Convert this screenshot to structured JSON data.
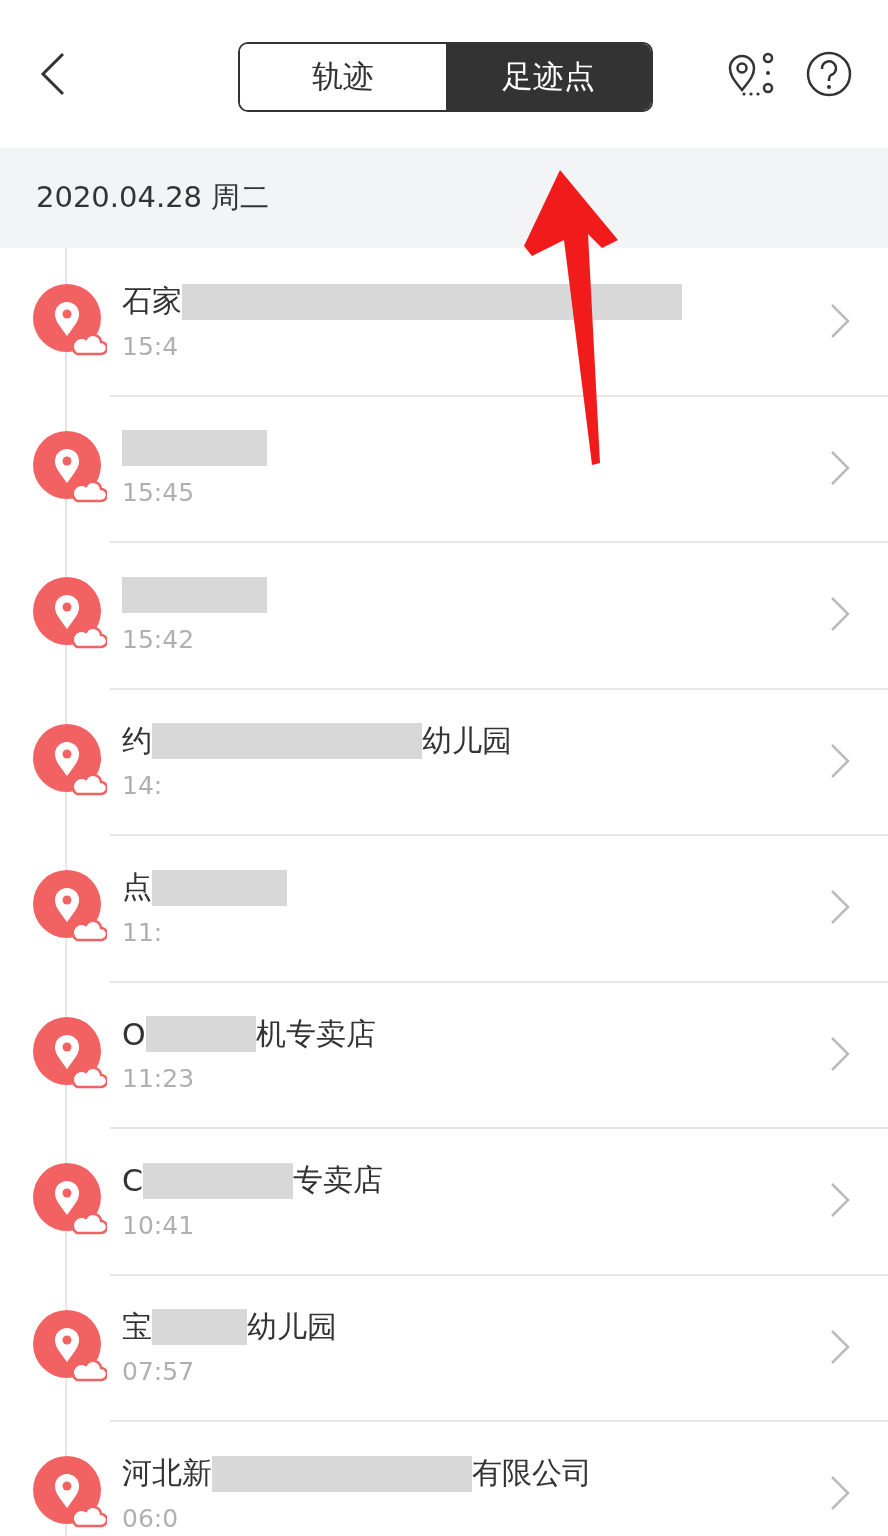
{
  "header": {
    "segments": [
      {
        "label": "轨迹",
        "selected": false
      },
      {
        "label": "足迹点",
        "selected": true
      }
    ]
  },
  "date_bar": {
    "date": "2020.04.28 周二"
  },
  "footprints": [
    {
      "title_prefix": "石家",
      "redacted": true,
      "time": "15:4"
    },
    {
      "redacted": true,
      "time": "15:45"
    },
    {
      "redacted": true,
      "time": "15:42"
    },
    {
      "title_prefix": "约",
      "redacted": true,
      "title_suffix": "幼儿园",
      "time": "14:"
    },
    {
      "title_prefix": "点",
      "redacted": true,
      "time": "11:"
    },
    {
      "title_prefix": "O",
      "redacted": true,
      "title_suffix": "机专卖店",
      "time": "11:23"
    },
    {
      "title_prefix": "C",
      "redacted": true,
      "title_suffix": "专卖店",
      "time": "10:41"
    },
    {
      "title_prefix": "宝",
      "redacted": true,
      "title_suffix": "幼儿园",
      "time": "07:57"
    },
    {
      "title_prefix": "河北新",
      "redacted": true,
      "title_suffix": "有限公司",
      "time": "06:0"
    }
  ]
}
